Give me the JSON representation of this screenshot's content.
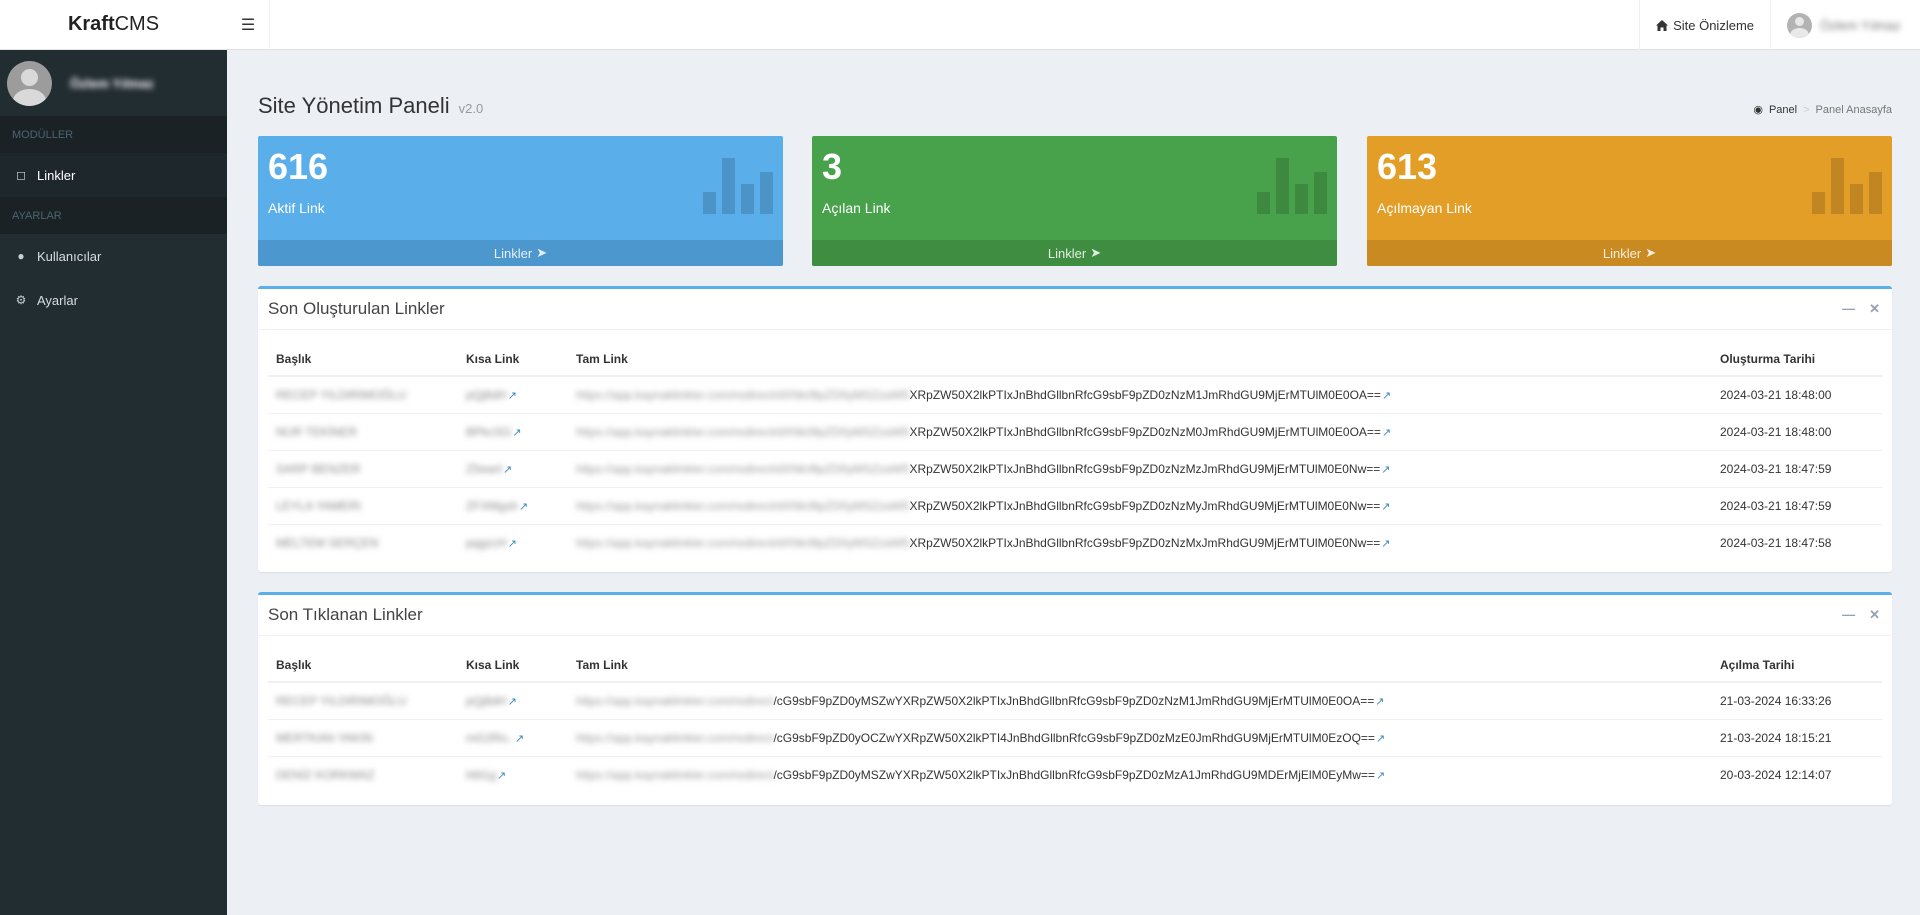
{
  "app": {
    "logo_bold": "Kraft",
    "logo_light": "CMS"
  },
  "header": {
    "toggle_icon": "bars-icon",
    "site_preview": "Site Önizleme",
    "user_name": "Özlem Yılmaz"
  },
  "sidebar": {
    "user_name": "Özlem Yılmaz",
    "section_modules": "MODÜLLER",
    "section_settings": "AYARLAR",
    "items": [
      {
        "label": "Linkler",
        "icon": "link-icon"
      },
      {
        "label": "Kullanıcılar",
        "icon": "user-icon"
      },
      {
        "label": "Ayarlar",
        "icon": "gear-icon"
      }
    ]
  },
  "page": {
    "title": "Site Yönetim Paneli",
    "version": "v2.0",
    "breadcrumb": {
      "home": "Panel",
      "current": "Panel Anasayfa"
    }
  },
  "stats": [
    {
      "value": "616",
      "label": "Aktif Link",
      "footer": "Linkler",
      "color": "#5aaeea"
    },
    {
      "value": "3",
      "label": "Açılan Link",
      "footer": "Linkler",
      "color": "#48a24b"
    },
    {
      "value": "613",
      "label": "Açılmayan Link",
      "footer": "Linkler",
      "color": "#e39e27"
    }
  ],
  "recent_created": {
    "title": "Son Oluşturulan Linkler",
    "columns": [
      "Başlık",
      "Kısa Link",
      "Tam Link",
      "Oluşturma Tarihi"
    ],
    "rows": [
      {
        "title": "RECEP YILDIRIMOĞLU",
        "short": "pQj8dH",
        "full_hidden": "https://app.kaynaklinkler.com/redirect/dXNlcl9pZD0yMSZzaW5",
        "full_visible": "XRpZW50X2lkPTIxJnBhdGllbnRfcG9sbF9pZD0zNzM1JmRhdGU9MjErMTUlM0E0OA==",
        "date": "2024-03-21 18:48:00"
      },
      {
        "title": "NUR TEKİNER",
        "short": "BPkcSG",
        "full_hidden": "https://app.kaynaklinkler.com/redirect/dXNlcl9pZD0yMSZzaW5",
        "full_visible": "XRpZW50X2lkPTIxJnBhdGllbnRfcG9sbF9pZD0zNzM0JmRhdGU9MjErMTUlM0E0OA==",
        "date": "2024-03-21 18:48:00"
      },
      {
        "title": "SARP BENZER",
        "short": "Z5ewrl",
        "full_hidden": "https://app.kaynaklinkler.com/redirect/dXNlcl9pZD0yMSZzaW5",
        "full_visible": "XRpZW50X2lkPTIxJnBhdGllbnRfcG9sbF9pZD0zNzMzJmRhdGU9MjErMTUlM0E0Nw==",
        "date": "2024-03-21 18:47:59"
      },
      {
        "title": "LEYLA YAMERI",
        "short": "ZFXMgsh",
        "full_hidden": "https://app.kaynaklinkler.com/redirect/dXNlcl9pZD0yMSZzaW5",
        "full_visible": "XRpZW50X2lkPTIxJnBhdGllbnRfcG9sbF9pZD0zNzMyJmRhdGU9MjErMTUlM0E0Nw==",
        "date": "2024-03-21 18:47:59"
      },
      {
        "title": "MELTEM SERÇEN",
        "short": "pqgzcH",
        "full_hidden": "https://app.kaynaklinkler.com/redirect/dXNlcl9pZD0yMSZzaW5",
        "full_visible": "XRpZW50X2lkPTIxJnBhdGllbnRfcG9sbF9pZD0zNzMxJmRhdGU9MjErMTUlM0E0Nw==",
        "date": "2024-03-21 18:47:58"
      }
    ]
  },
  "recent_clicked": {
    "title": "Son Tıklanan Linkler",
    "columns": [
      "Başlık",
      "Kısa Link",
      "Tam Link",
      "Açılma Tarihi"
    ],
    "rows": [
      {
        "title": "RECEP YILDIRIMOĞLU",
        "short": "pQj8dH",
        "full_hidden": "https://app.kaynaklinkler.com/redirect",
        "full_visible": "/cG9sbF9pZD0yMSZwYXRpZW50X2lkPTIxJnBhdGllbnRfcG9sbF9pZD0zNzM1JmRhdGU9MjErMTUlM0E0OA==",
        "date": "21-03-2024 16:33:26"
      },
      {
        "title": "MERTKAN YAKIN",
        "short": "mG2Ro..",
        "full_hidden": "https://app.kaynaklinkler.com/redirect",
        "full_visible": "/cG9sbF9pZD0yOCZwYXRpZW50X2lkPTI4JnBhdGllbnRfcG9sbF9pZD0zMzE0JmRhdGU9MjErMTUlM0EzOQ==",
        "date": "21-03-2024 18:15:21"
      },
      {
        "title": "DENİZ KORKMAZ",
        "short": "h6t1g",
        "full_hidden": "https://app.kaynaklinkler.com/redirect",
        "full_visible": "/cG9sbF9pZD0yMSZwYXRpZW50X2lkPTIxJnBhdGllbnRfcG9sbF9pZD0zMzA1JmRhdGU9MDErMjElM0EyMw==",
        "date": "20-03-2024 12:14:07"
      }
    ]
  }
}
